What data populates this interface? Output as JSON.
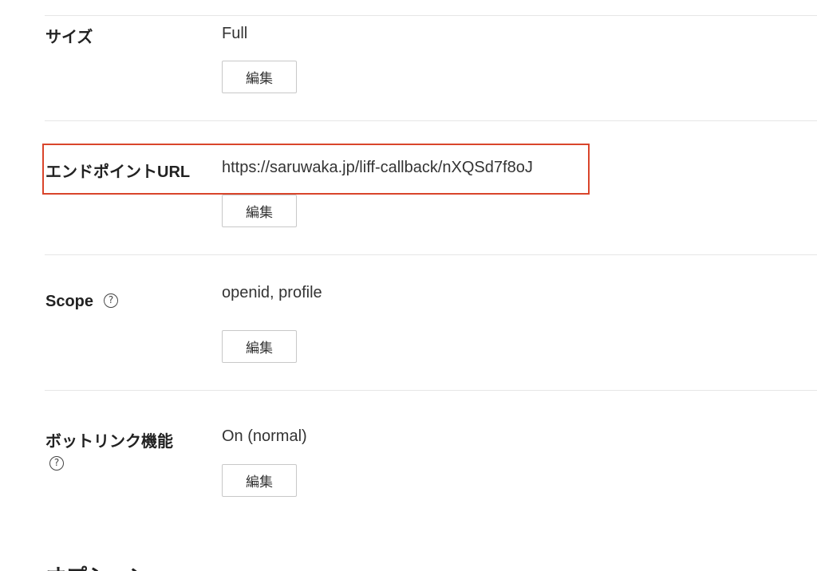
{
  "rows": [
    {
      "label": "サイズ",
      "value": "Full",
      "edit_label": "編集"
    },
    {
      "label": "エンドポイントURL",
      "value": "https://saruwaka.jp/liff-callback/nXQSd7f8oJ",
      "edit_label": "編集"
    },
    {
      "label": "Scope",
      "value": "openid, profile",
      "edit_label": "編集"
    },
    {
      "label": "ボットリンク機能",
      "value": "On (normal)",
      "edit_label": "編集"
    }
  ],
  "help_icon_glyph": "?",
  "options_heading": "オプション",
  "highlight_color": "#d9452b"
}
